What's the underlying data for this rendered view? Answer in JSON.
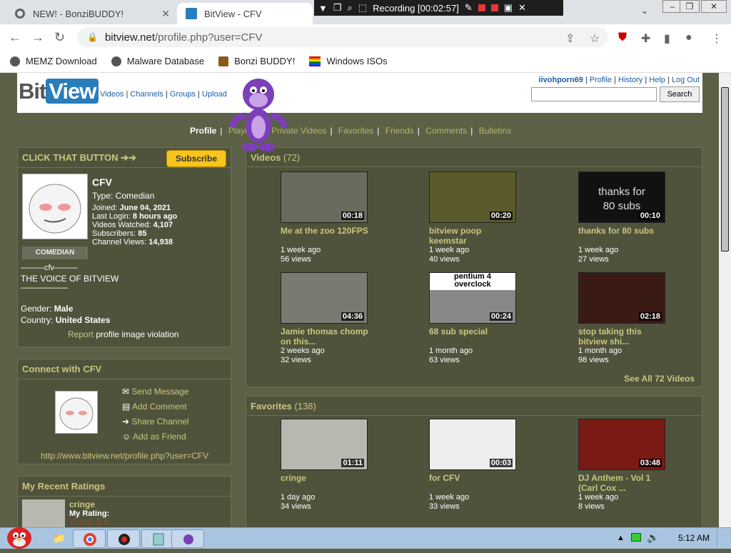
{
  "browser": {
    "tabs": [
      {
        "title": "NEW! - BonziBUDDY!",
        "active": false
      },
      {
        "title": "BitView - CFV",
        "active": true
      }
    ],
    "recording": "Recording [00:02:57]",
    "url_host": "bitview.net",
    "url_path": "/profile.php?user=CFV",
    "bookmarks": [
      "MEMZ Download",
      "Malware Database",
      "Bonzi BUDDY!",
      "Windows ISOs"
    ]
  },
  "site": {
    "logo_bit": "Bit",
    "logo_view": "View",
    "nav": [
      "Videos",
      "Channels",
      "Groups",
      "Upload"
    ],
    "user": "iivohporn69",
    "user_links": [
      "Profile",
      "History",
      "Help",
      "Log Out"
    ],
    "search_label": "Search"
  },
  "subnav": [
    "Profile",
    "Playlists",
    "Private Videos",
    "Favorites",
    "Friends",
    "Comments",
    "Bulletins"
  ],
  "profile": {
    "cta": "CLICK THAT BUTTON ➔➔",
    "subscribe": "Subscribe",
    "name": "CFV",
    "type": "Type: Comedian",
    "joined_label": "Joined:",
    "joined": "June 04, 2021",
    "last_login_label": "Last Login:",
    "last_login": "8 hours ago",
    "watched_label": "Videos Watched:",
    "watched": "4,107",
    "subs_label": "Subscribers:",
    "subs": "85",
    "views_label": "Channel Views:",
    "views": "14,938",
    "badge": "COMEDIAN",
    "bio1": "———cfv———",
    "bio2": "THE VOICE OF BITVIEW",
    "bio3": "——————",
    "gender_label": "Gender:",
    "gender": "Male",
    "country_label": "Country:",
    "country": "United States",
    "report": "Report",
    "report_rest": "profile image violation"
  },
  "connect": {
    "title": "Connect with CFV",
    "actions": [
      "Send Message",
      "Add Comment",
      "Share Channel",
      "Add as Friend"
    ],
    "url": "http://www.bitview.net/profile.php?user=CFV"
  },
  "ratings": {
    "title": "My Recent Ratings",
    "item": "cringe",
    "my_rating": "My Rating:"
  },
  "videos": {
    "title": "Videos",
    "count": "(72)",
    "items": [
      {
        "title": "Me at the zoo 120FPS",
        "title2": "",
        "dur": "00:18",
        "age": "1 week ago",
        "views": "56 views",
        "bg": "#6b6a5e"
      },
      {
        "title": "bitview poop",
        "title2": "keemstar",
        "dur": "00:20",
        "age": "1 week ago",
        "views": "40 views",
        "bg": "#5b5a2a"
      },
      {
        "title": "thanks for 80 subs",
        "title2": "",
        "dur": "00:10",
        "age": "1 week ago",
        "views": "27 views",
        "bg": "#111"
      },
      {
        "title": "Jamie thomas chomp",
        "title2": "on this...",
        "dur": "04:36",
        "age": "2 weeks ago",
        "views": "32 views",
        "bg": "#7a7a72"
      },
      {
        "title": "68 sub special",
        "title2": "",
        "dur": "00:24",
        "age": "1 month ago",
        "views": "63 views",
        "bg": "#888"
      },
      {
        "title": "stop taking this",
        "title2": "bitview shi...",
        "dur": "02:18",
        "age": "1 month ago",
        "views": "98 views",
        "bg": "#3a1a14"
      }
    ],
    "see_all": "See All 72 Videos"
  },
  "favorites": {
    "title": "Favorites",
    "count": "(138)",
    "items": [
      {
        "title": "cringe",
        "title2": "",
        "dur": "01:11",
        "age": "1 day ago",
        "views": "34 views",
        "bg": "#b8b8b0"
      },
      {
        "title": "for CFV",
        "title2": "",
        "dur": "00:03",
        "age": "1 week ago",
        "views": "33 views",
        "bg": "#eee"
      },
      {
        "title": "DJ Anthem - Vol 1",
        "title2": "(Carl Cox ...",
        "dur": "03:48",
        "age": "1 week ago",
        "views": "8 views",
        "bg": "#7a1a14"
      }
    ]
  },
  "thumb_texts": {
    "subs80a": "thanks for",
    "subs80b": "80 subs",
    "pentium": "pentium 4",
    "overclock": "overclock"
  },
  "taskbar": {
    "time": "5:12 AM"
  }
}
